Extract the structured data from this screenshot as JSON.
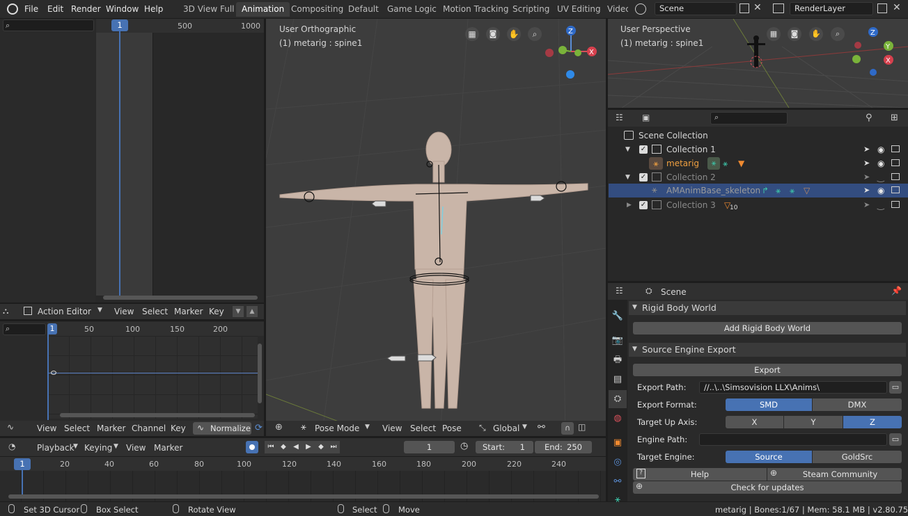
{
  "menubar": {
    "items": [
      "File",
      "Edit",
      "Render",
      "Window",
      "Help"
    ]
  },
  "workspaces": [
    "3D View Full",
    "Animation",
    "Compositing",
    "Default",
    "Game Logic",
    "Motion Tracking",
    "Scripting",
    "UV Editing",
    "Videc"
  ],
  "scene_selector": {
    "value": "Scene"
  },
  "layer_selector": {
    "value": "RenderLayer"
  },
  "dopesheet_top": {
    "frame": "1",
    "ticks": [
      "500",
      "1000"
    ]
  },
  "action_editor": {
    "mode": "Action Editor",
    "menus": [
      "View",
      "Select",
      "Marker",
      "Key"
    ]
  },
  "graph": {
    "frame": "1",
    "ticks": [
      "50",
      "100",
      "150",
      "200"
    ],
    "menus": [
      "View",
      "Select",
      "Marker",
      "Channel",
      "Key"
    ],
    "normalize": "Normalize"
  },
  "viewport_main": {
    "view_name": "User Orthographic",
    "object_info": "(1) metarig : spine1",
    "mode": "Pose Mode",
    "menus": [
      "View",
      "Select",
      "Pose"
    ],
    "orientation": "Global"
  },
  "viewport_small": {
    "view_name": "User Perspective",
    "object_info": "(1) metarig : spine1"
  },
  "outliner": {
    "root": "Scene Collection",
    "rows": [
      {
        "label": "Collection 1"
      },
      {
        "label": "metarig"
      },
      {
        "label": "Collection 2"
      },
      {
        "label": "AMAnimBase_skeleton"
      },
      {
        "label": "Collection 3",
        "badge": "10"
      }
    ]
  },
  "properties": {
    "context": "Scene",
    "rigid_body": {
      "title": "Rigid Body World",
      "button": "Add Rigid Body World"
    },
    "source_export": {
      "title": "Source Engine Export",
      "export_button": "Export",
      "export_path_label": "Export Path:",
      "export_path": "//..\\..\\Simsovision LLX\\Anims\\",
      "export_format_label": "Export Format:",
      "formats": [
        "SMD",
        "DMX"
      ],
      "up_axis_label": "Target Up Axis:",
      "axes": [
        "X",
        "Y",
        "Z"
      ],
      "engine_path_label": "Engine Path:",
      "target_engine_label": "Target Engine:",
      "engines": [
        "Source",
        "GoldSrc"
      ],
      "help": "Help",
      "community": "Steam Community",
      "updates": "Check for updates"
    }
  },
  "timeline": {
    "menus": [
      "Playback",
      "Keying",
      "View",
      "Marker"
    ],
    "current_frame": "1",
    "start_label": "Start:",
    "start": "1",
    "end_label": "End:",
    "end": "250",
    "ticks": [
      "20",
      "40",
      "60",
      "80",
      "100",
      "120",
      "140",
      "160",
      "180",
      "200",
      "220",
      "240"
    ]
  },
  "statusbar": {
    "hints": [
      "Set 3D Cursor",
      "Box Select",
      "Rotate View",
      "Select",
      "Move"
    ],
    "info": "metarig | Bones:1/67 | Mem: 58.1 MB | v2.80.75"
  },
  "colors": {
    "accent": "#4772b3",
    "selected_row": "#334d80",
    "viewport_bg": "#3d3d3d",
    "orange_text": "#f0a040"
  }
}
